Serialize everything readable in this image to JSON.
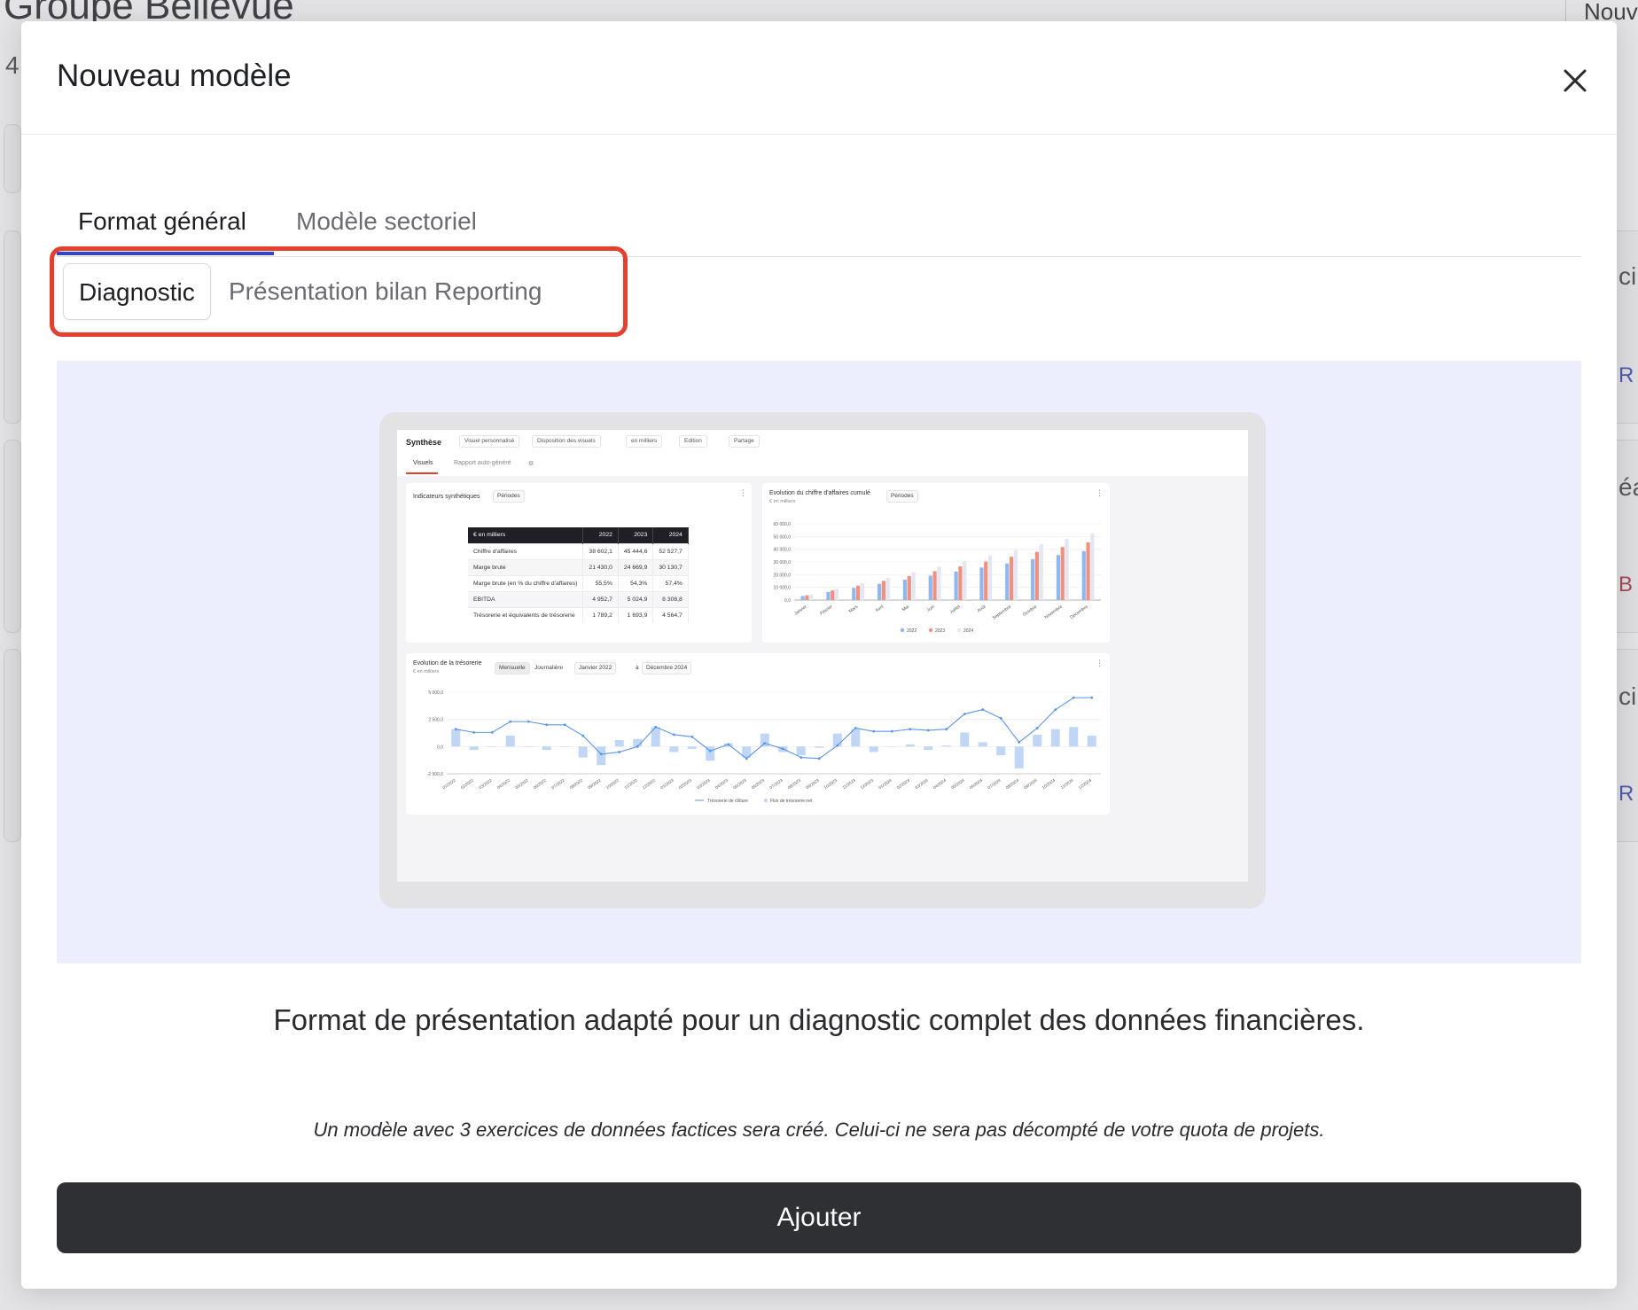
{
  "background": {
    "title": "Groupe Bellevue",
    "count": "4",
    "top_right": "Nouv",
    "right_fragments": [
      "ci",
      "R",
      "éa",
      "B",
      "ci",
      "R"
    ]
  },
  "modal": {
    "title": "Nouveau modèle",
    "close_icon": "close-icon",
    "tabs": [
      {
        "label": "Format général",
        "active": true
      },
      {
        "label": "Modèle sectoriel",
        "active": false
      }
    ],
    "segments": [
      {
        "label": "Diagnostic",
        "active": true
      },
      {
        "label": "Présentation bilan",
        "active": false
      },
      {
        "label": "Reporting",
        "active": false
      }
    ],
    "description": "Format de présentation adapté pour un diagnostic complet des données financières.",
    "note": "Un modèle avec 3 exercices de données factices sera créé. Celui-ci ne sera pas décompté de votre quota de projets.",
    "add_label": "Ajouter",
    "highlight_color": "#e5402e",
    "accent_color": "#3446c6",
    "button_color": "#2e3033"
  },
  "preview": {
    "title": "Synthèse",
    "toolbar": [
      "Visuel personnalisé",
      "Disposition des visuels",
      "en milliers",
      "Edition",
      "Partage"
    ],
    "subtabs": [
      "Visuels",
      "Rapport auto-généré"
    ],
    "indicators": {
      "title": "Indicateurs synthétiques",
      "filter": "Périodes",
      "headers": [
        "€ en milliers",
        "2022",
        "2023",
        "2024"
      ],
      "rows": [
        [
          "Chiffre d'affaires",
          "38 602,1",
          "45 444,6",
          "52 527,7"
        ],
        [
          "Marge brute",
          "21 430,0",
          "24 669,9",
          "30 130,7"
        ],
        [
          "Marge brute (en % du chiffre d'affaires)",
          "55,5%",
          "54,3%",
          "57,4%"
        ],
        [
          "EBITDA",
          "4 952,7",
          "5 024,9",
          "8 308,8"
        ],
        [
          "Trésorerie et équivalents de trésorerie",
          "1 789,2",
          "1 693,9",
          "4 564,7"
        ]
      ]
    },
    "revenue_chart": {
      "title": "Evolution du chiffre d'affaires cumulé",
      "subtitle": "€ en milliers",
      "filter": "Périodes"
    },
    "cash_chart": {
      "title": "Evolution de la trésorerie",
      "subtitle": "€ en milliers",
      "mode_options": [
        "Mensuelle",
        "Journalière"
      ],
      "from": "Janvier 2022",
      "to_word": "à",
      "to": "Décembre 2024"
    }
  },
  "chart_data": [
    {
      "type": "bar",
      "title": "Evolution du chiffre d'affaires cumulé",
      "ylabel": "€ en milliers",
      "ylim": [
        0,
        60000
      ],
      "yticks": [
        "60 000,0",
        "50 000,0",
        "40 000,0",
        "30 000,0",
        "20 000,0",
        "10 000,0",
        "0,0"
      ],
      "categories": [
        "Janvier",
        "Février",
        "Mars",
        "Avril",
        "Mai",
        "Juin",
        "Juillet",
        "Août",
        "Septembre",
        "Octobre",
        "Novembre",
        "Décembre"
      ],
      "series": [
        {
          "name": "2022",
          "color": "#8fb8f0",
          "values": [
            3200,
            6400,
            9600,
            12800,
            16000,
            19200,
            22400,
            25600,
            28800,
            32100,
            35400,
            38602
          ]
        },
        {
          "name": "2023",
          "color": "#f0907e",
          "values": [
            3800,
            7600,
            11300,
            15100,
            18900,
            22700,
            26500,
            30300,
            34100,
            37900,
            41700,
            45445
          ]
        },
        {
          "name": "2024",
          "color": "#e3e6f5",
          "values": [
            4400,
            8800,
            13100,
            17500,
            21900,
            26300,
            30600,
            35000,
            39400,
            43800,
            48100,
            52528
          ]
        }
      ],
      "legend": "bottom"
    },
    {
      "type": "bar+line",
      "title": "Evolution de la trésorerie",
      "ylabel": "€ en milliers",
      "ylim": [
        -2500,
        5000
      ],
      "yticks": [
        "5 000,0",
        "2 500,0",
        "0,0",
        "-2 500,0"
      ],
      "categories": [
        "01/2022",
        "02/2022",
        "03/2022",
        "04/2022",
        "05/2022",
        "06/2022",
        "07/2022",
        "08/2022",
        "09/2022",
        "10/2022",
        "11/2022",
        "12/2022",
        "01/2023",
        "02/2023",
        "03/2023",
        "04/2023",
        "05/2023",
        "06/2023",
        "07/2023",
        "08/2023",
        "09/2023",
        "10/2023",
        "11/2023",
        "12/2023",
        "01/2024",
        "02/2024",
        "03/2024",
        "04/2024",
        "05/2024",
        "06/2024",
        "07/2024",
        "08/2024",
        "09/2024",
        "10/2024",
        "11/2024",
        "12/2024"
      ],
      "series": [
        {
          "name": "Trésorerie de clôture",
          "kind": "line",
          "color": "#5b95e8",
          "values": [
            1600,
            1300,
            1300,
            2300,
            2300,
            2000,
            2000,
            1000,
            -700,
            -500,
            0,
            1800,
            1100,
            900,
            -400,
            200,
            -1100,
            300,
            -200,
            -1000,
            -1100,
            100,
            1700,
            1400,
            1400,
            1600,
            1500,
            1600,
            3000,
            3400,
            2600,
            400,
            1700,
            3400,
            4500,
            4500
          ]
        },
        {
          "name": "Flux de trésorerie net",
          "kind": "bar",
          "color": "#bfd6f5",
          "values": [
            1600,
            -300,
            0,
            1000,
            0,
            -300,
            0,
            -1000,
            -1700,
            600,
            700,
            1800,
            -500,
            -200,
            -1300,
            300,
            -1000,
            1200,
            -500,
            -800,
            -100,
            1200,
            1600,
            -500,
            0,
            200,
            -300,
            100,
            1300,
            400,
            -800,
            -2000,
            1100,
            1600,
            1800,
            1000
          ]
        }
      ],
      "legend": "bottom"
    }
  ]
}
